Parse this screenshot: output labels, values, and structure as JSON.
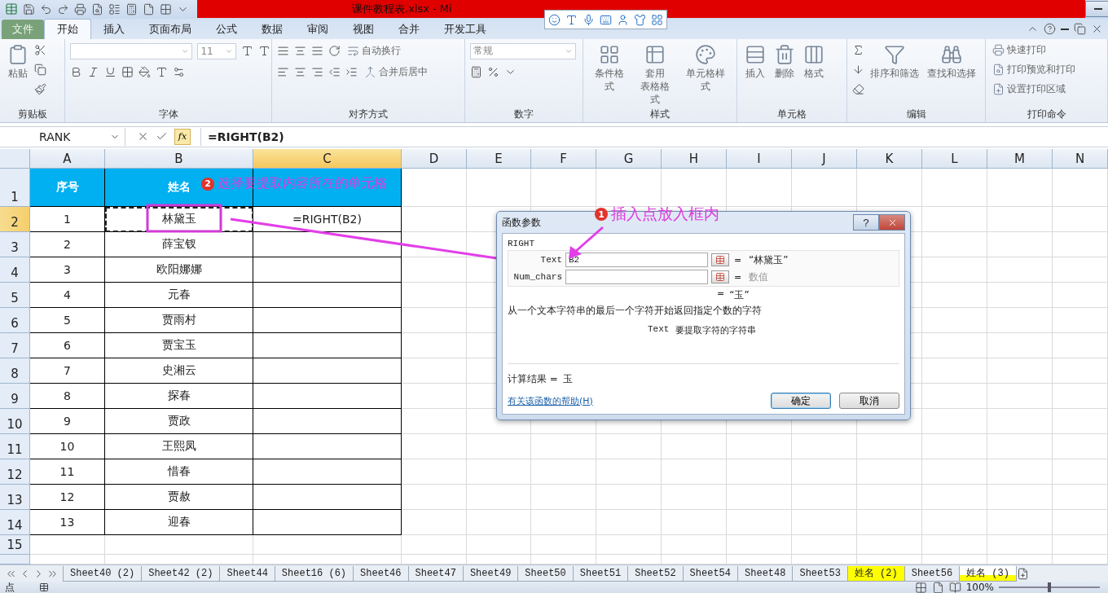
{
  "title_bar": {
    "title": "课件教程表.xlsx - Mi"
  },
  "ribbon_tabs": [
    {
      "label": "文件",
      "selected": false,
      "kind": "file"
    },
    {
      "label": "开始",
      "selected": true,
      "kind": "tab"
    },
    {
      "label": "插入",
      "selected": false,
      "kind": "tab"
    },
    {
      "label": "页面布局",
      "selected": false,
      "kind": "tab"
    },
    {
      "label": "公式",
      "selected": false,
      "kind": "tab"
    },
    {
      "label": "数据",
      "selected": false,
      "kind": "tab"
    },
    {
      "label": "审阅",
      "selected": false,
      "kind": "tab"
    },
    {
      "label": "视图",
      "selected": false,
      "kind": "tab"
    },
    {
      "label": "合并",
      "selected": false,
      "kind": "tab"
    },
    {
      "label": "开发工具",
      "selected": false,
      "kind": "tab"
    }
  ],
  "ribbon_groups": [
    {
      "label": "剪贴板",
      "buttons": [
        "粘贴"
      ]
    },
    {
      "label": "字体",
      "font_size": "11"
    },
    {
      "label": "对齐方式",
      "buttons": [
        "自动换行",
        "合并后居中"
      ]
    },
    {
      "label": "数字",
      "number_format": "常规"
    },
    {
      "label": "样式",
      "buttons": [
        "条件格式",
        [
          "套用",
          "表格格式"
        ],
        "单元格样式"
      ]
    },
    {
      "label": "单元格",
      "buttons": [
        "插入",
        "删除",
        "格式"
      ]
    },
    {
      "label": "编辑",
      "buttons": [
        "排序和筛选",
        "查找和选择"
      ]
    },
    {
      "label": "打印命令",
      "buttons": [
        "快速打印",
        "打印预览和打印",
        "设置打印区域"
      ]
    }
  ],
  "formula_bar": {
    "name_box": "RANK",
    "function_button": "fx",
    "formula": "=RIGHT(B2)"
  },
  "columns": [
    {
      "label": "A",
      "selected": false
    },
    {
      "label": "B",
      "selected": false
    },
    {
      "label": "C",
      "selected": true
    },
    {
      "label": "D",
      "selected": false
    },
    {
      "label": "E",
      "selected": false
    },
    {
      "label": "F",
      "selected": false
    },
    {
      "label": "G",
      "selected": false
    },
    {
      "label": "H",
      "selected": false
    },
    {
      "label": "I",
      "selected": false
    },
    {
      "label": "J",
      "selected": false
    },
    {
      "label": "K",
      "selected": false
    },
    {
      "label": "L",
      "selected": false
    },
    {
      "label": "M",
      "selected": false
    },
    {
      "label": "N",
      "selected": false
    }
  ],
  "row_numbers": [
    {
      "label": "1",
      "selected": false
    },
    {
      "label": "2",
      "selected": true
    },
    {
      "label": "3",
      "selected": false
    },
    {
      "label": "4",
      "selected": false
    },
    {
      "label": "5",
      "selected": false
    },
    {
      "label": "6",
      "selected": false
    },
    {
      "label": "7",
      "selected": false
    },
    {
      "label": "8",
      "selected": false
    },
    {
      "label": "9",
      "selected": false
    },
    {
      "label": "10",
      "selected": false
    },
    {
      "label": "11",
      "selected": false
    },
    {
      "label": "12",
      "selected": false
    },
    {
      "label": "13",
      "selected": false
    },
    {
      "label": "14",
      "selected": false
    },
    {
      "label": "15",
      "selected": false
    }
  ],
  "table": {
    "header": [
      "序号",
      "姓名"
    ],
    "rows": [
      {
        "no": "1",
        "name": "林黛玉",
        "marquee": true,
        "formula": "=RIGHT(B2)"
      },
      {
        "no": "2",
        "name": "薛宝钗",
        "marquee": false
      },
      {
        "no": "3",
        "name": "欧阳娜娜",
        "marquee": false
      },
      {
        "no": "4",
        "name": "元春",
        "marquee": false
      },
      {
        "no": "5",
        "name": "贾雨村",
        "marquee": false
      },
      {
        "no": "6",
        "name": "贾宝玉",
        "marquee": false
      },
      {
        "no": "7",
        "name": "史湘云",
        "marquee": false
      },
      {
        "no": "8",
        "name": "探春",
        "marquee": false
      },
      {
        "no": "9",
        "name": "贾政",
        "marquee": false
      },
      {
        "no": "10",
        "name": "王熙凤",
        "marquee": false
      },
      {
        "no": "11",
        "name": "惜春",
        "marquee": false
      },
      {
        "no": "12",
        "name": "贾赦",
        "marquee": false
      },
      {
        "no": "13",
        "name": "迎春",
        "marquee": false
      }
    ]
  },
  "dialog": {
    "title": "函数参数",
    "help_button": "?",
    "function_name": "RIGHT",
    "arguments": [
      {
        "name": "Text",
        "value": "B2",
        "equals": "=",
        "result": "“林黛玉”",
        "kind": "value"
      },
      {
        "name": "Num_chars",
        "equals": "=",
        "result": "数值",
        "kind": "hint"
      }
    ],
    "overall_equals": "=",
    "overall_result": "“玉”",
    "description": "从一个文本字符串的最后一个字符开始返回指定个数的字符",
    "arg_help_name": "Text",
    "arg_help": "要提取字符的字符串",
    "calc_label": "计算结果 =",
    "calc_value": "玉",
    "help_link": "有关该函数的帮助(H)",
    "buttons": [
      {
        "label": "确定",
        "kind": "default"
      },
      {
        "label": "取消",
        "kind": "normal"
      }
    ]
  },
  "annotations": [
    {
      "badge": "2",
      "text": "选择要提取内容所在的单元格"
    },
    {
      "badge": "1",
      "text": "插入点放入框内"
    }
  ],
  "sheet_tabs": [
    {
      "label": "Sheet40 (2)",
      "selected": false
    },
    {
      "label": "Sheet42 (2)",
      "selected": false
    },
    {
      "label": "Sheet44",
      "selected": false
    },
    {
      "label": "Sheet16 (6)",
      "selected": false
    },
    {
      "label": "Sheet46",
      "selected": false
    },
    {
      "label": "Sheet47",
      "selected": false
    },
    {
      "label": "Sheet49",
      "selected": false
    },
    {
      "label": "Sheet50",
      "selected": false
    },
    {
      "label": "Sheet51",
      "selected": false
    },
    {
      "label": "Sheet52",
      "selected": false
    },
    {
      "label": "Sheet54",
      "selected": false
    },
    {
      "label": "Sheet48",
      "selected": false
    },
    {
      "label": "Sheet53",
      "selected": false
    },
    {
      "label": "姓名 (2)",
      "selected": false,
      "color": "#ffff00"
    },
    {
      "label": "Sheet56",
      "selected": false
    },
    {
      "label": "姓名 (3)",
      "selected": true,
      "color": "#ffff00"
    }
  ],
  "status_bar": {
    "mode": "点",
    "zoom": {
      "reading": "100%",
      "level": 0.5
    }
  }
}
